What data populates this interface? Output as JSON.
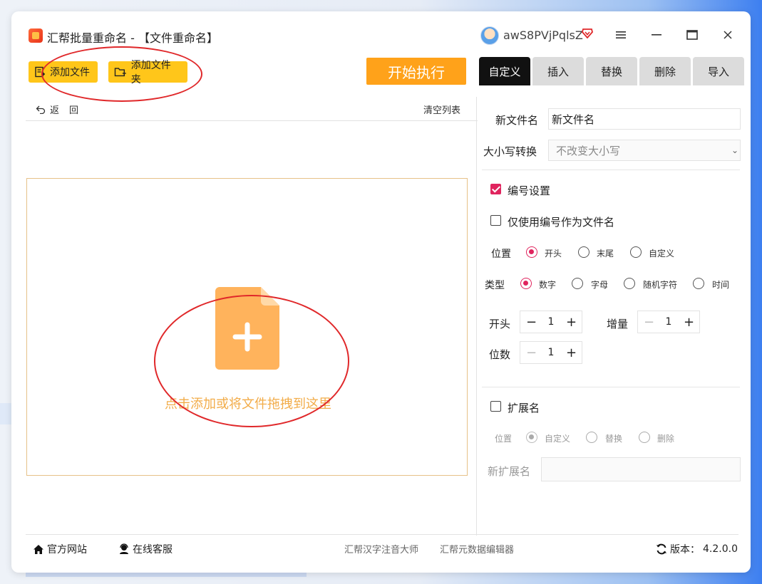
{
  "window": {
    "title": "汇帮批量重命名 - 【文件重命名】",
    "username": "awS8PVjPqlsZ"
  },
  "toolbar": {
    "add_file": "添加文件",
    "add_folder": "添加文件夹",
    "start": "开始执行",
    "back": "返回",
    "clear_list": "清空列表"
  },
  "dropzone": {
    "hint": "点击添加或将文件拖拽到这里"
  },
  "tabs": [
    {
      "label": "自定义",
      "active": true
    },
    {
      "label": "插入"
    },
    {
      "label": "替换"
    },
    {
      "label": "删除"
    },
    {
      "label": "导入"
    }
  ],
  "settings": {
    "new_name_label": "新文件名",
    "new_name_value": "新文件名",
    "case_label": "大小写转换",
    "case_value": "不改变大小写",
    "numbering_label": "编号设置",
    "numbering_checked": true,
    "only_number_label": "仅使用编号作为文件名",
    "only_number_checked": false,
    "position_label": "位置",
    "position_options": [
      "开头",
      "末尾",
      "自定义"
    ],
    "position_selected": "开头",
    "type_label": "类型",
    "type_options": [
      "数字",
      "字母",
      "随机字符",
      "时间"
    ],
    "type_selected": "数字",
    "start_label": "开头",
    "start_value": "1",
    "increment_label": "增量",
    "increment_value": "1",
    "digits_label": "位数",
    "digits_value": "1",
    "ext_label": "扩展名",
    "ext_checked": false,
    "ext_position_label": "位置",
    "ext_position_options": [
      "自定义",
      "替换",
      "删除"
    ],
    "ext_position_selected": "自定义",
    "new_ext_label": "新扩展名",
    "new_ext_value": ""
  },
  "footer": {
    "website": "官方网站",
    "support": "在线客服",
    "link1": "汇帮汉字注音大师",
    "link2": "汇帮元数据编辑器",
    "version_label": "版本：",
    "version": "4.2.0.0"
  },
  "colors": {
    "accent": "#e0245e",
    "yellow_button": "#ffc61a",
    "start_button": "#ffa21a",
    "drop_icon": "#ffb35c",
    "annotation_red": "#e0282a"
  }
}
